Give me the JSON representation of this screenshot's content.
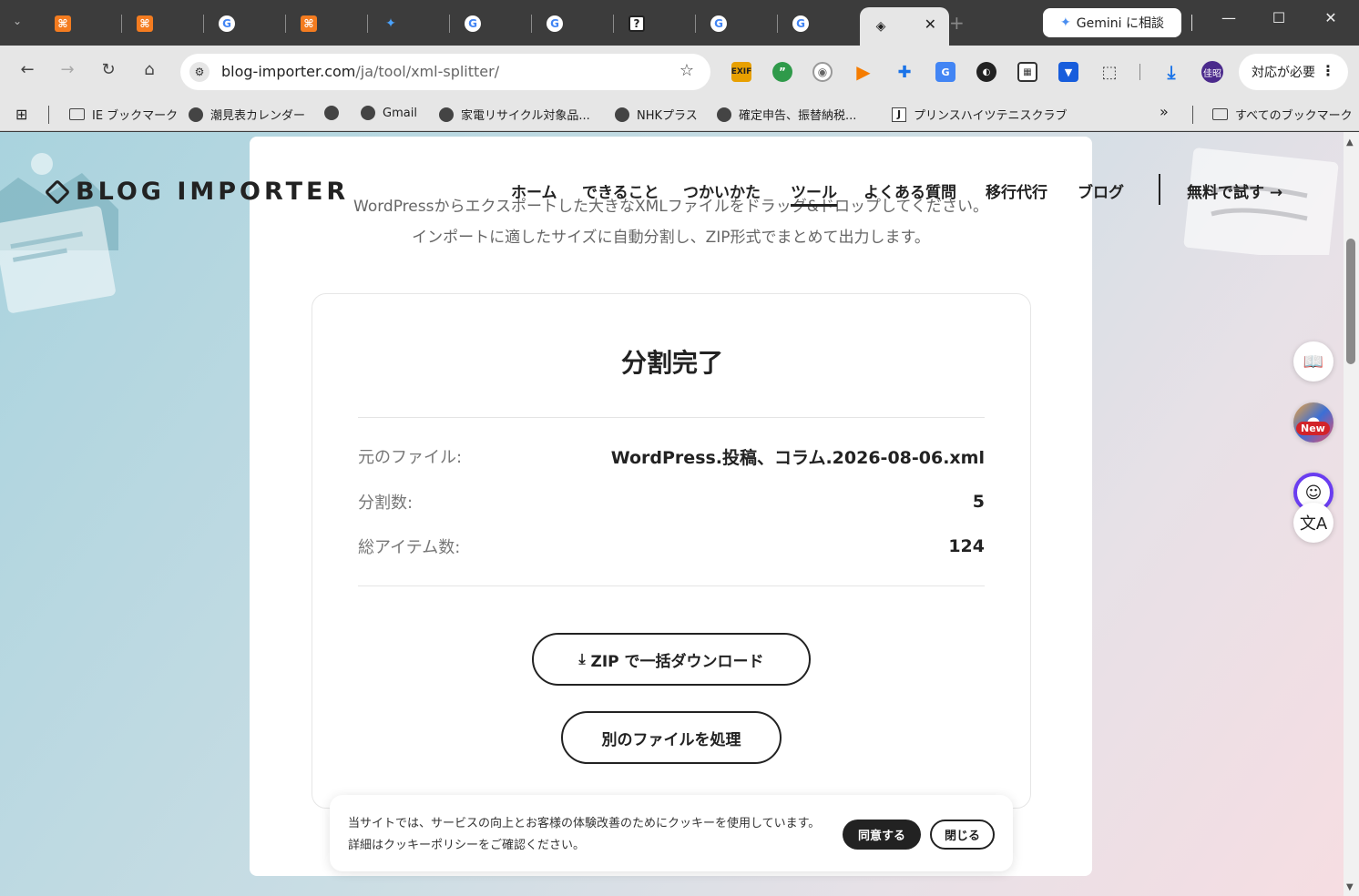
{
  "browser": {
    "tabs": [
      {
        "icon": "xampp"
      },
      {
        "icon": "xampp"
      },
      {
        "icon": "google"
      },
      {
        "icon": "xampp"
      },
      {
        "icon": "gemini"
      },
      {
        "icon": "google"
      },
      {
        "icon": "google"
      },
      {
        "icon": "help"
      },
      {
        "icon": "google"
      },
      {
        "icon": "google"
      },
      {
        "icon": "blog-importer",
        "active": true
      }
    ],
    "gemini_button": "Gemini に相談",
    "url_host": "blog-importer.com",
    "url_path": "/ja/tool/xml-splitter/",
    "profile_initials": "佳昭",
    "action_button": "対応が必要",
    "extensions": [
      "EXIF",
      "quote",
      "rss",
      "play",
      "vpn",
      "translate",
      "camera",
      "qr",
      "bitwarden",
      "puzzle"
    ]
  },
  "bookmarks": {
    "items": [
      "IE ブックマーク",
      "潮見表カレンダー",
      "",
      "Gmail",
      "家電リサイクル対象品...",
      "NHKプラス",
      "確定申告、振替納税...",
      "プリンスハイツテニスクラブ"
    ],
    "more": "»",
    "all": "すべてのブックマーク"
  },
  "site": {
    "logo": "BLOG IMPORTER",
    "nav": [
      "ホーム",
      "できること",
      "つかいかた",
      "ツール",
      "よくある質問",
      "移行代行",
      "ブログ"
    ],
    "cta": "無料で試す →",
    "lead_line1": "WordPressからエクスポートした大きなXMLファイルをドラッグ&ドロップしてください。",
    "lead_line2": "インポートに適したサイズに自動分割し、ZIP形式でまとめて出力します。"
  },
  "result": {
    "title": "分割完了",
    "rows": [
      {
        "label": "元のファイル:",
        "value": "WordPress.投稿、コラム.2026-08-06.xml"
      },
      {
        "label": "分割数:",
        "value": "5"
      },
      {
        "label": "総アイテム数:",
        "value": "124"
      }
    ],
    "download_button": "ZIP で一括ダウンロード",
    "another_button": "別のファイルを処理"
  },
  "cookie": {
    "message": "当サイトでは、サービスの向上とお客様の体験改善のためにクッキーを使用しています。詳細はクッキーポリシーをご確認ください。",
    "agree": "同意する",
    "close": "閉じる"
  },
  "side_tools": {
    "new_badge": "New"
  }
}
